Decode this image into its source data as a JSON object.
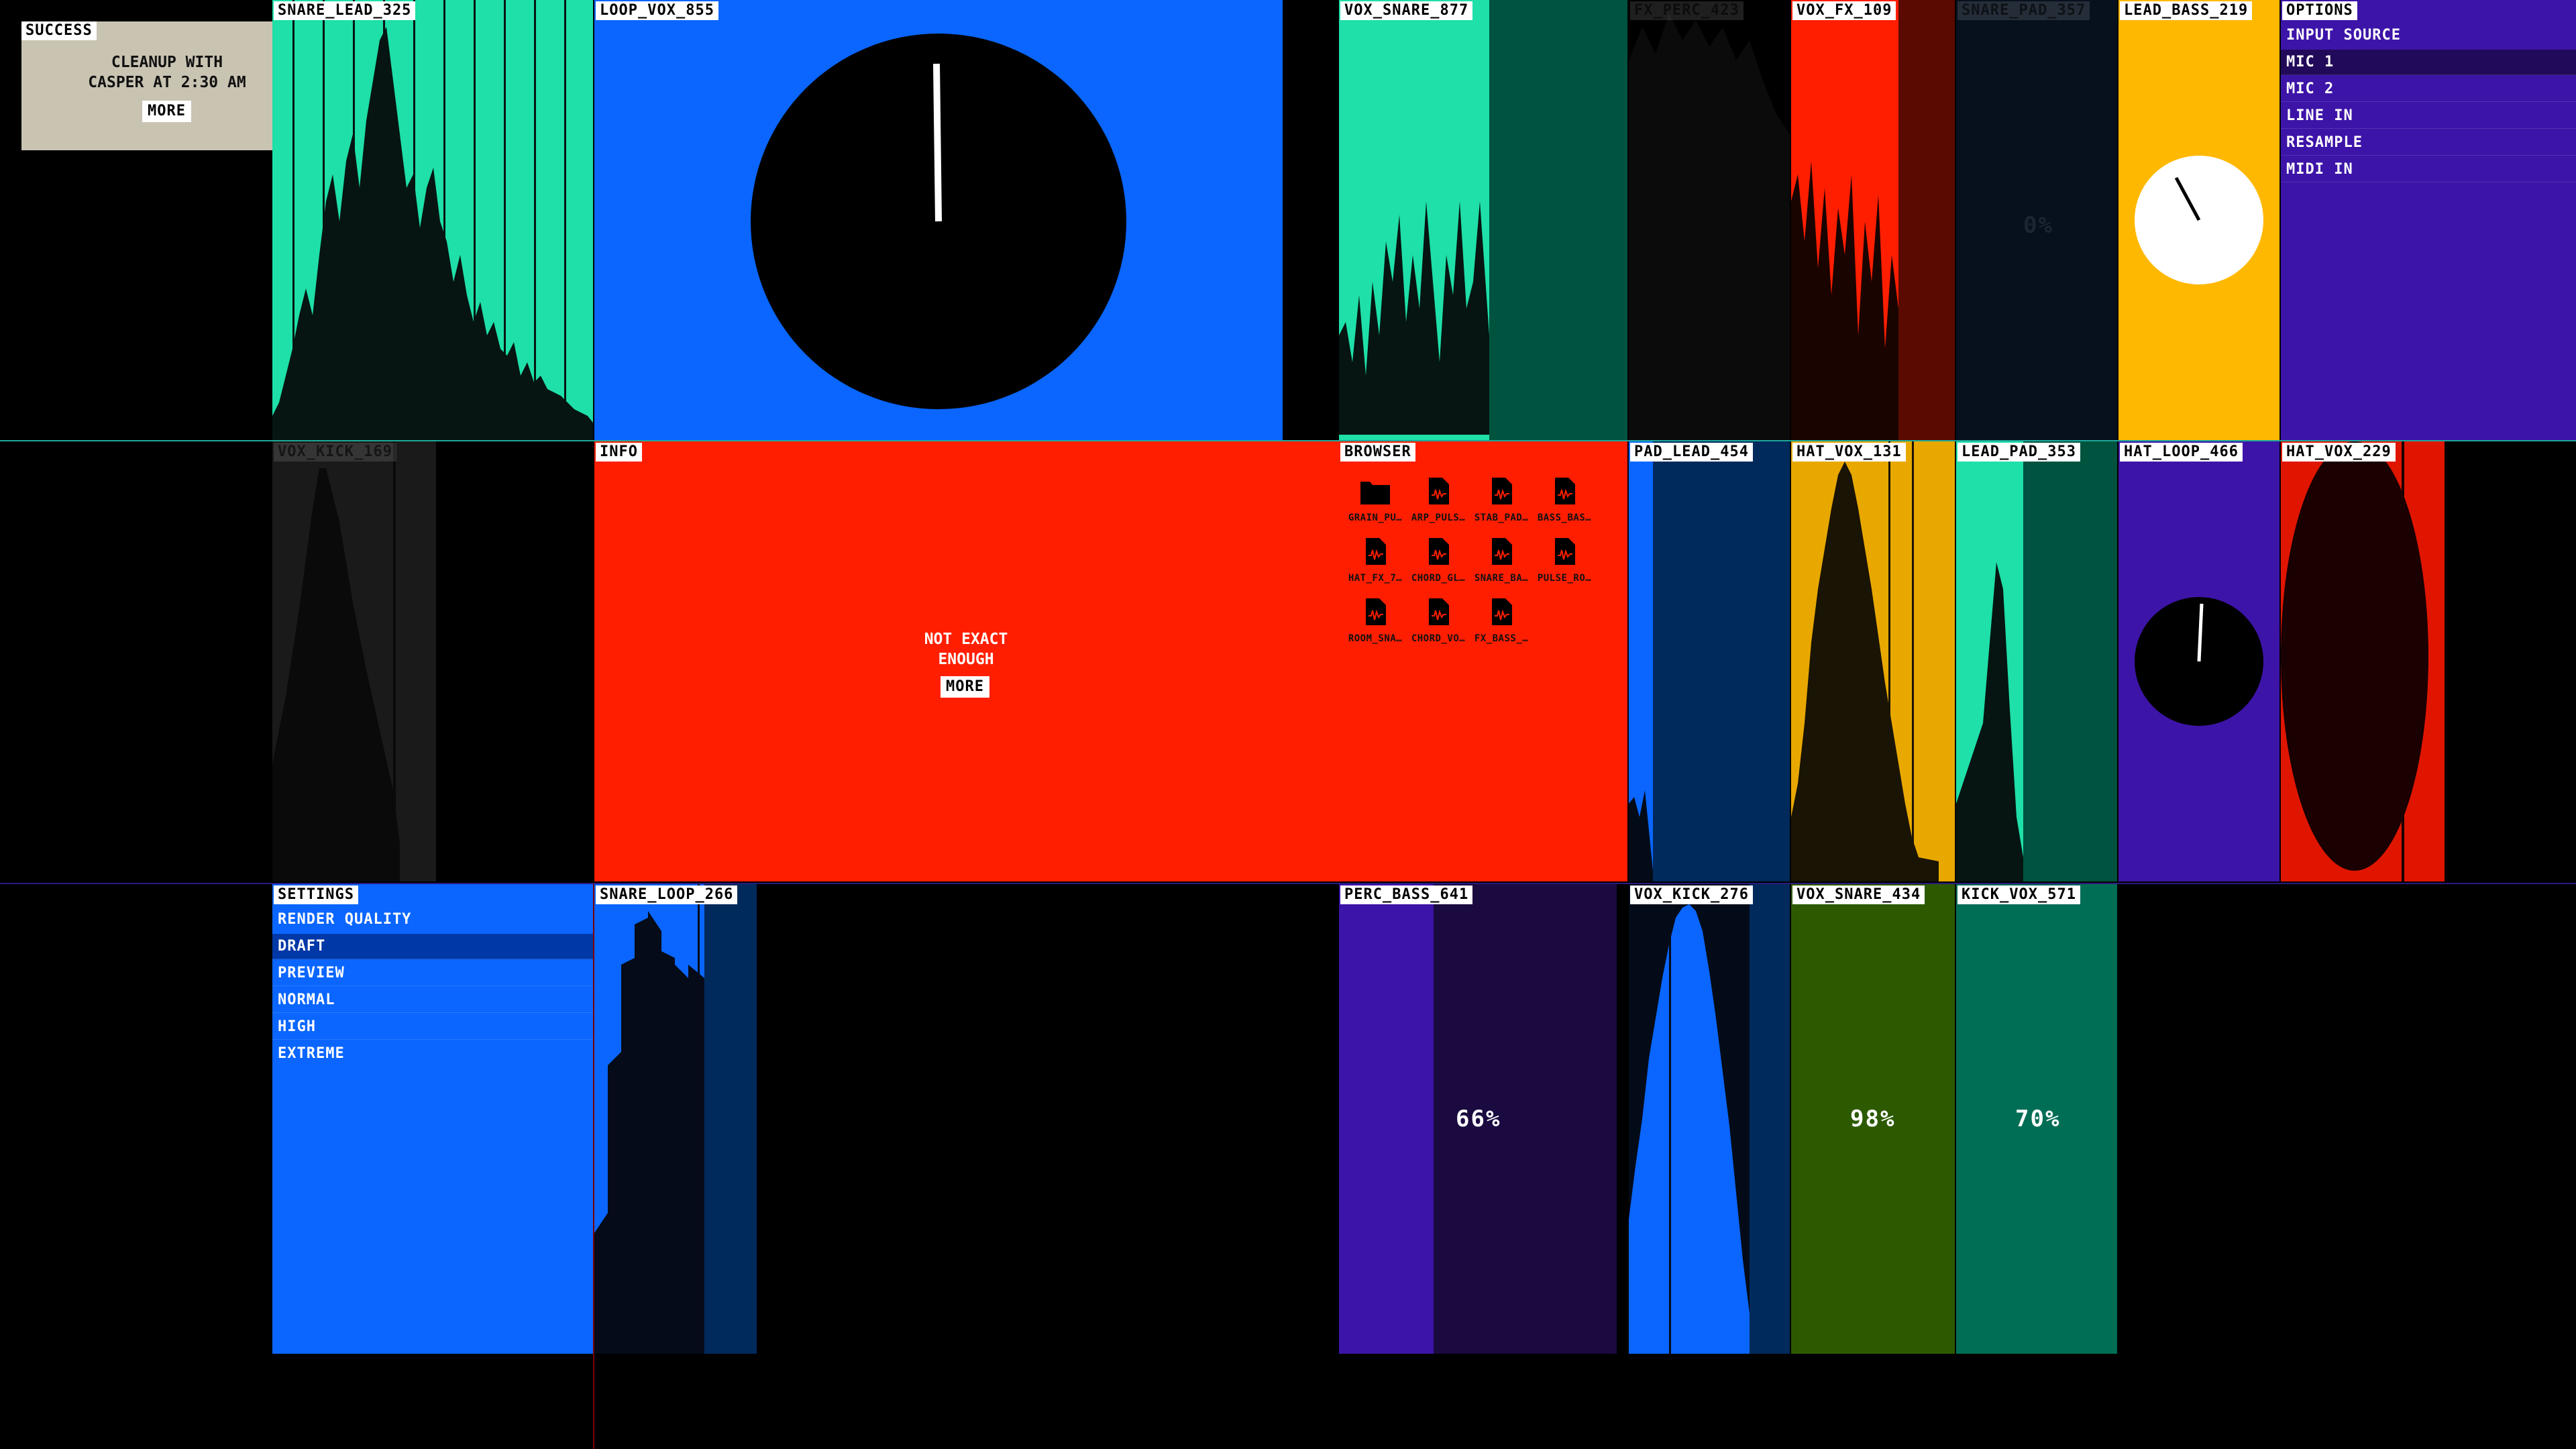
{
  "notification": {
    "tag": "SUCCESS",
    "line1": "CLEANUP WITH",
    "line2": "CASPER AT 2:30 AM",
    "button": "MORE"
  },
  "info": {
    "tag": "INFO",
    "line1": "NOT EXACT",
    "line2": "ENOUGH",
    "button": "MORE"
  },
  "options": {
    "tag": "OPTIONS",
    "title": "INPUT SOURCE",
    "items": [
      "MIC 1",
      "MIC 2",
      "LINE IN",
      "RESAMPLE",
      "MIDI IN"
    ],
    "selected": "MIC 1"
  },
  "settings": {
    "tag": "SETTINGS",
    "title": "RENDER QUALITY",
    "items": [
      "DRAFT",
      "PREVIEW",
      "NORMAL",
      "HIGH",
      "EXTREME"
    ],
    "selected": "DRAFT"
  },
  "browser": {
    "tag": "BROWSER",
    "files": [
      {
        "name": "GRAIN_PU…",
        "icon": "folder-icon"
      },
      {
        "name": "ARP_PULS…",
        "icon": "audio-file-icon"
      },
      {
        "name": "STAB_PAD…",
        "icon": "audio-file-icon"
      },
      {
        "name": "BASS_BAS…",
        "icon": "audio-file-icon"
      },
      {
        "name": "HAT_FX_7…",
        "icon": "audio-file-icon"
      },
      {
        "name": "CHORD_GL…",
        "icon": "audio-file-icon"
      },
      {
        "name": "SNARE_BA…",
        "icon": "audio-file-icon"
      },
      {
        "name": "PULSE_RO…",
        "icon": "audio-file-icon"
      },
      {
        "name": "ROOM_SNA…",
        "icon": "audio-file-icon"
      },
      {
        "name": "CHORD_VO…",
        "icon": "audio-file-icon"
      },
      {
        "name": "FX_BASS_…",
        "icon": "audio-file-icon"
      }
    ]
  },
  "tracks": {
    "snare_lead_325": "SNARE_LEAD_325",
    "loop_vox_855": "LOOP_VOX_855",
    "vox_snare_877": "VOX_SNARE_877",
    "fx_perc_423": "FX_PERC_423",
    "vox_fx_109": "VOX_FX_109",
    "snare_pad_357": "SNARE_PAD_357",
    "lead_bass_219": "LEAD_BASS_219",
    "vox_kick_169": "VOX_KICK_169",
    "pad_lead_454": "PAD_LEAD_454",
    "hat_vox_131": "HAT_VOX_131",
    "lead_pad_353": "LEAD_PAD_353",
    "hat_loop_466": "HAT_LOOP_466",
    "hat_vox_229": "HAT_VOX_229",
    "snare_loop_266": "SNARE_LOOP_266",
    "perc_bass_641": "PERC_BASS_641",
    "vox_kick_276": "VOX_KICK_276",
    "vox_snare_434": "VOX_SNARE_434",
    "kick_vox_571": "KICK_VOX_571"
  },
  "percents": {
    "snare_pad_357": "0%",
    "perc_bass_641": "66%",
    "vox_snare_434": "98%",
    "kick_vox_571": "70%"
  },
  "meters": {
    "snare_pad_357": 0.0,
    "perc_bass_641": 0.66,
    "vox_snare_434": 0.98,
    "kick_vox_571": 0.7
  },
  "colors": {
    "mint": "#1ee0a8",
    "blue": "#0a66ff",
    "red": "#ff1e00",
    "yellow": "#ffb800",
    "purple": "#3d14a8",
    "teal": "#006e55",
    "green": "#2d5a00",
    "navy": "#002a5c"
  }
}
